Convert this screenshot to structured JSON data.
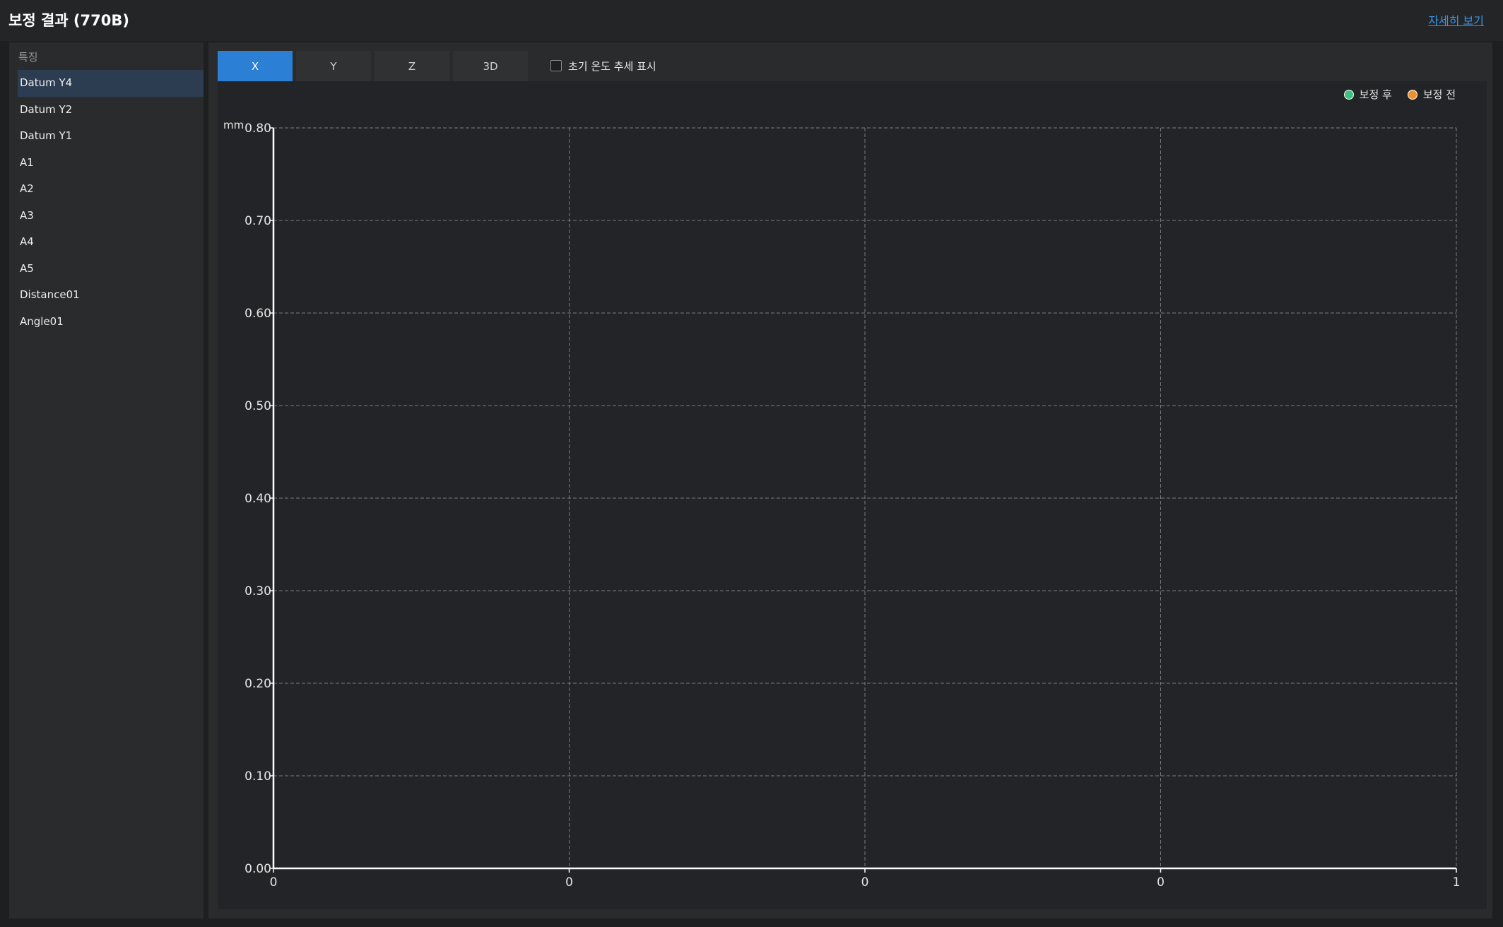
{
  "header": {
    "title": "보정 결과 (770B)",
    "detail_link": "자세히 보기"
  },
  "sidebar": {
    "header": "특징",
    "items": [
      {
        "label": "Datum Y4",
        "selected": true
      },
      {
        "label": "Datum Y2",
        "selected": false
      },
      {
        "label": "Datum Y1",
        "selected": false
      },
      {
        "label": "A1",
        "selected": false
      },
      {
        "label": "A2",
        "selected": false
      },
      {
        "label": "A3",
        "selected": false
      },
      {
        "label": "A4",
        "selected": false
      },
      {
        "label": "A5",
        "selected": false
      },
      {
        "label": "Distance01",
        "selected": false
      },
      {
        "label": "Angle01",
        "selected": false
      }
    ]
  },
  "tabs": [
    {
      "label": "X",
      "active": true
    },
    {
      "label": "Y",
      "active": false
    },
    {
      "label": "Z",
      "active": false
    },
    {
      "label": "3D",
      "active": false
    }
  ],
  "trend_toggle": {
    "label": "초기 온도 추세 표시",
    "checked": false
  },
  "colors": {
    "accent": "#2b7fd4",
    "selected_row": "#2c3d52",
    "after_series": "#3fbf7f",
    "before_series": "#f0922b",
    "link": "#3d94e6"
  },
  "chart_data": {
    "type": "scatter",
    "title": "",
    "ylabel": "mm",
    "xlabel": "",
    "ylim": [
      0,
      0.8
    ],
    "yticks": [
      "0.00",
      "0.10",
      "0.20",
      "0.30",
      "0.40",
      "0.50",
      "0.60",
      "0.70",
      "0.80"
    ],
    "xticks": [
      "0",
      "0",
      "0",
      "0",
      "1"
    ],
    "grid": true,
    "legend_position": "top-right",
    "series": [
      {
        "name": "보정 후",
        "color": "#3fbf7f",
        "points": []
      },
      {
        "name": "보정 전",
        "color": "#f0922b",
        "points": []
      }
    ]
  }
}
